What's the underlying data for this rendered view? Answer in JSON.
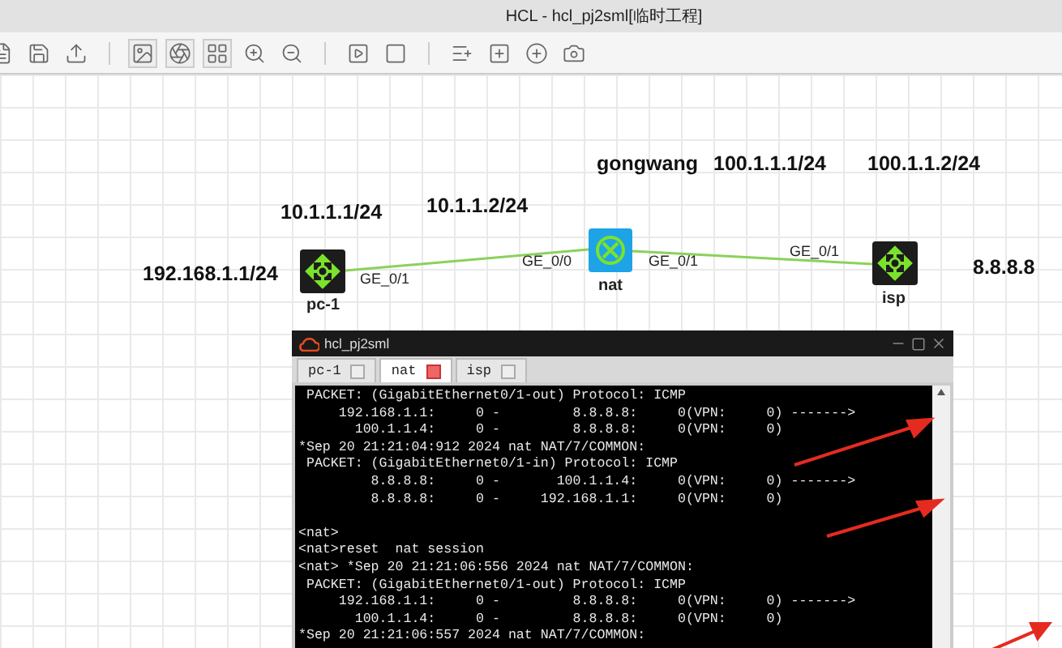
{
  "window": {
    "title": "HCL - hcl_pj2sml[临时工程]"
  },
  "canvas": {
    "devices": [
      {
        "name": "pc-1",
        "kind": "router"
      },
      {
        "name": "nat",
        "kind": "switch"
      },
      {
        "name": "isp",
        "kind": "router"
      }
    ],
    "links": [
      {
        "from_port": "GE_0/1",
        "to_port": "GE_0/0"
      },
      {
        "from_port": "GE_0/1",
        "to_port": "GE_0/1"
      }
    ],
    "labels": [
      "192.168.1.1/24",
      "10.1.1.1/24",
      "10.1.1.2/24",
      "gongwang",
      "100.1.1.1/24",
      "100.1.1.2/24",
      "8.8.8.8"
    ]
  },
  "terminal": {
    "title": "hcl_pj2sml",
    "tabs": [
      {
        "label": "pc-1",
        "selected": false
      },
      {
        "label": "nat",
        "selected": true
      },
      {
        "label": "isp",
        "selected": false
      }
    ],
    "lines": [
      {
        "text": " PACKET: (GigabitEthernet0/1-out) Protocol: ICMP"
      },
      {
        "text": "     192.168.1.1:     0 -         8.8.8.8:     0(VPN:     0) ------->"
      },
      {
        "text": "       100.1.1.4:     0 -         8.8.8.8:     0(VPN:     0)"
      },
      {
        "text": "*Sep 20 21:21:04:912 2024 nat NAT/7/COMMON:"
      },
      {
        "text": " PACKET: (GigabitEthernet0/1-in) Protocol: ICMP"
      },
      {
        "text": "         8.8.8.8:     0 -       100.1.1.4:     0(VPN:     0) ------->"
      },
      {
        "text": "         8.8.8.8:     0 -     192.168.1.1:     0(VPN:     0)"
      },
      {
        "text": "<nat>",
        "blank_before": true
      },
      {
        "text": "<nat>reset  nat session"
      },
      {
        "text": "<nat> *Sep 20 21:21:06:556 2024 nat NAT/7/COMMON:"
      },
      {
        "text": " PACKET: (GigabitEthernet0/1-out) Protocol: ICMP"
      },
      {
        "text": "     192.168.1.1:     0 -         8.8.8.8:     0(VPN:     0) ------->"
      },
      {
        "text": "       100.1.1.4:     0 -         8.8.8.8:     0(VPN:     0)"
      },
      {
        "text": "*Sep 20 21:21:06:557 2024 nat NAT/7/COMMON:"
      }
    ]
  }
}
